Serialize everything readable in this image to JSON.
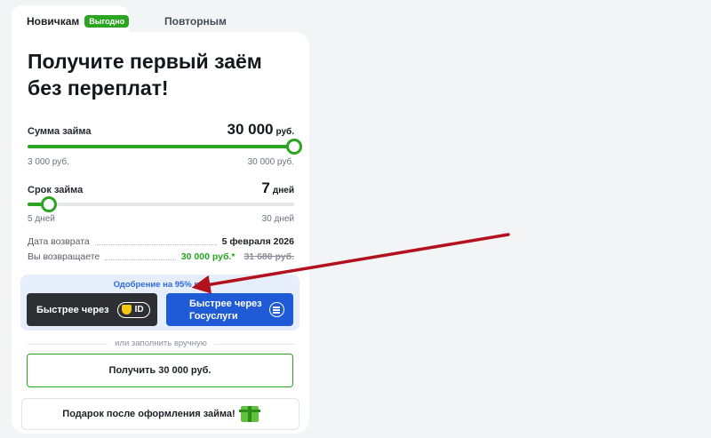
{
  "tabs": {
    "newbies": "Новичкам",
    "badge": "Выгодно",
    "repeat": "Повторным"
  },
  "title": "Получите первый заём без переплат!",
  "amount": {
    "label": "Сумма займа",
    "value": "30 000",
    "unit": "руб.",
    "min": "3 000 руб.",
    "max": "30 000 руб.",
    "fraction": 1.0
  },
  "term": {
    "label": "Срок займа",
    "value": "7",
    "unit": "дней",
    "min": "5 дней",
    "max": "30 дней",
    "fraction": 0.08
  },
  "return_date": {
    "label": "Дата возврата",
    "value": "5 февраля 2026"
  },
  "repay": {
    "label": "Вы возвращаете",
    "value": "30 000 руб.*",
    "old_value": "31 680 руб."
  },
  "approval": {
    "text": "Одобрение на 95% вы",
    "btn_id_label": "Быстрее через",
    "id_text": "ID",
    "btn_gos_line1": "Быстрее через",
    "btn_gos_line2": "Госуслуги"
  },
  "divider": "или заполнить вручную",
  "get_button": "Получить 30 000 руб.",
  "gift_text": "Подарок после оформления займа!",
  "colors": {
    "green": "#2aa520",
    "blue": "#1f5bd6",
    "dark": "#2d2f33",
    "arrow": "#b3111d"
  }
}
